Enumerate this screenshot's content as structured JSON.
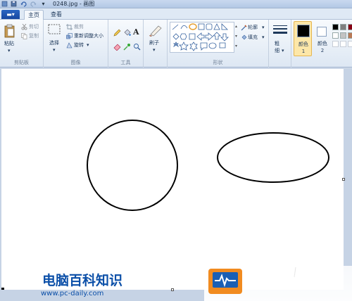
{
  "window": {
    "title": "0248.jpg - 画图",
    "quick_access": [
      "save-icon",
      "undo-icon",
      "redo-icon",
      "dropdown-icon"
    ]
  },
  "tabs": {
    "file_label": "",
    "items": [
      {
        "label": "主页",
        "active": true
      },
      {
        "label": "查看",
        "active": false
      }
    ]
  },
  "ribbon": {
    "clipboard": {
      "paste_label": "粘贴",
      "cut_label": "剪切",
      "copy_label": "复制",
      "group_label": "剪贴板"
    },
    "image": {
      "select_label": "选择",
      "crop_label": "裁剪",
      "resize_label": "重新调整大小",
      "rotate_label": "旋转",
      "group_label": "图像"
    },
    "tools": {
      "group_label": "工具",
      "items": [
        "pencil-icon",
        "fill-icon",
        "text-icon",
        "eraser-icon",
        "color-picker-icon",
        "magnifier-icon"
      ]
    },
    "brushes": {
      "label": "刷子"
    },
    "shapes": {
      "outline_label": "轮廓",
      "fill_label": "填充",
      "group_label": "形状"
    },
    "size": {
      "label": "粗细"
    },
    "colors": {
      "color1_label": "颜色 1",
      "color2_label": "颜色 2",
      "color1": "#000000",
      "color2": "#ffffff",
      "palette": [
        "#000000",
        "#7f7f7f",
        "#880015",
        "#ffffff",
        "#c3c3c3",
        "#b97a57"
      ]
    }
  },
  "watermark": {
    "title": "电脑百科知识",
    "url": "www.pc-daily.com"
  }
}
